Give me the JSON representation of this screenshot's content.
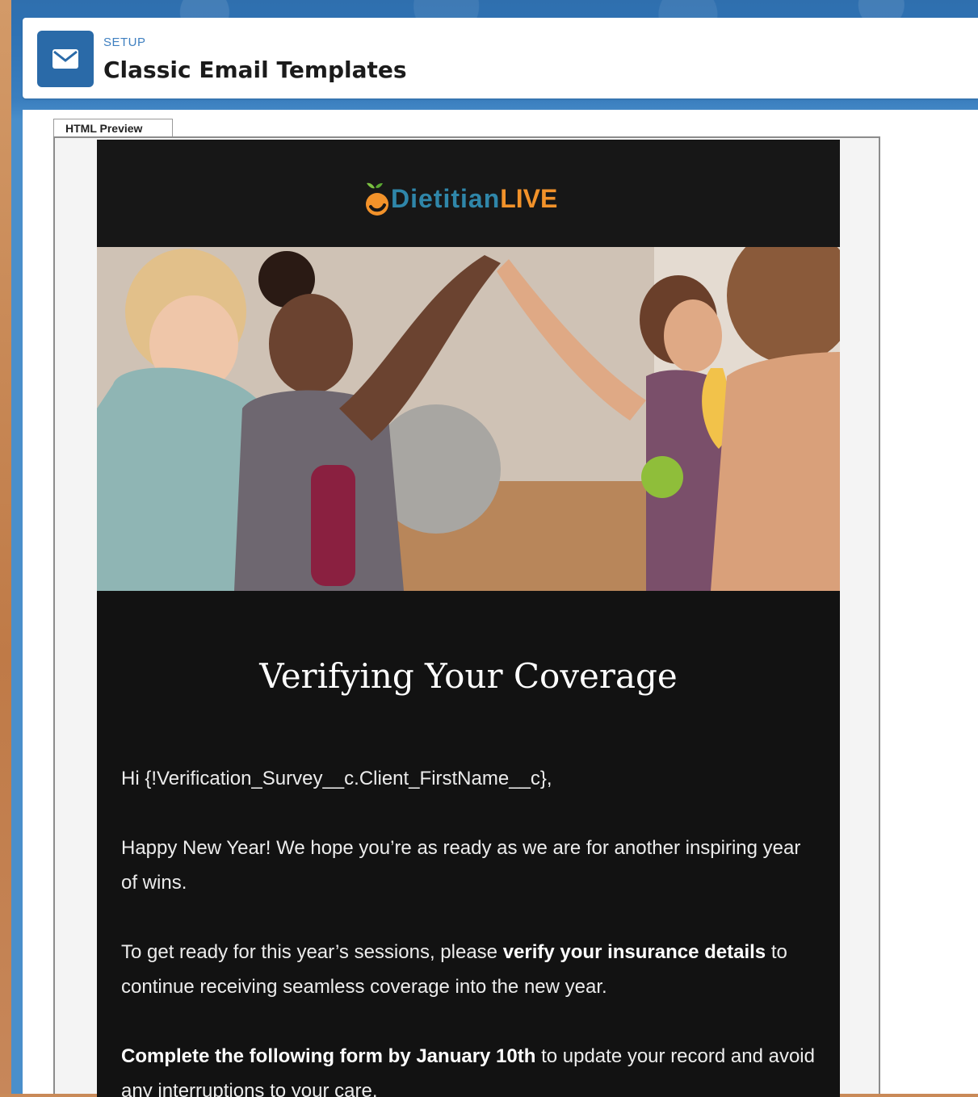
{
  "header": {
    "eyebrow": "SETUP",
    "title": "Classic Email Templates",
    "icon": "envelope-icon"
  },
  "preview": {
    "tab_label": "HTML Preview"
  },
  "email": {
    "logo": {
      "part1": "Dietitian",
      "part2": "LIVE"
    },
    "title": "Verifying Your Coverage",
    "greeting": "Hi {!Verification_Survey__c.Client_FirstName__c},",
    "para1": "Happy New Year! We hope you’re as ready as we are for another inspiring year of wins.",
    "para2_pre": "To get ready for this year’s sessions, please ",
    "para2_bold": "verify your insurance details",
    "para2_post": " to continue receiving seamless coverage into the new year.",
    "para3_bold": "Complete the following form by January 10th",
    "para3_post": " to update your record and avoid any interruptions to your care."
  },
  "colors": {
    "brand_blue": "#2a6aa8",
    "logo_blue": "#2f86a9",
    "logo_orange": "#f2922a",
    "email_bg": "#121212"
  }
}
